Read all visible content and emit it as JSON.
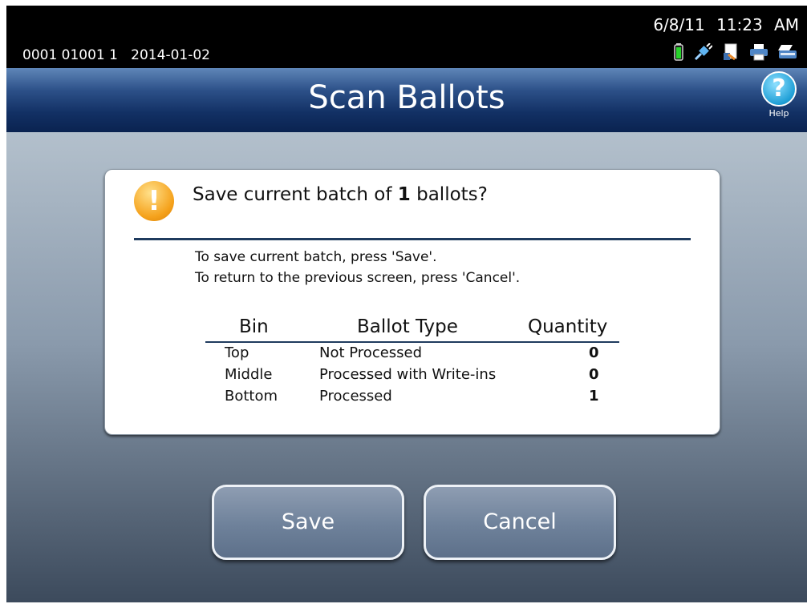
{
  "status_bar": {
    "ids": "0001 01001 1   2014-01-02",
    "date": "6/8/11",
    "time": "11:23 AM",
    "icons": [
      "battery-icon",
      "network-connection-icon",
      "document-icon",
      "printer-icon",
      "scanner-icon"
    ]
  },
  "header": {
    "title": "Scan Ballots",
    "help_label": "Help",
    "help_glyph": "?"
  },
  "dialog": {
    "title_pre": "Save current batch of ",
    "title_count": "1",
    "title_post": " ballots?",
    "instructions": [
      "To save current batch, press 'Save'.",
      "To return to the previous screen, press 'Cancel'."
    ],
    "table": {
      "headers": {
        "bin": "Bin",
        "type": "Ballot Type",
        "quantity": "Quantity"
      },
      "rows": [
        {
          "bin": "Top",
          "type": "Not Processed",
          "quantity": "0"
        },
        {
          "bin": "Middle",
          "type": "Processed with Write-ins",
          "quantity": "0"
        },
        {
          "bin": "Bottom",
          "type": "Processed",
          "quantity": "1"
        }
      ]
    }
  },
  "buttons": {
    "save": "Save",
    "cancel": "Cancel"
  },
  "colors": {
    "title_bar": "#123064",
    "warning_icon": "#f5a21c",
    "help_icon": "#1f9fd6",
    "button": "#6e819a"
  }
}
